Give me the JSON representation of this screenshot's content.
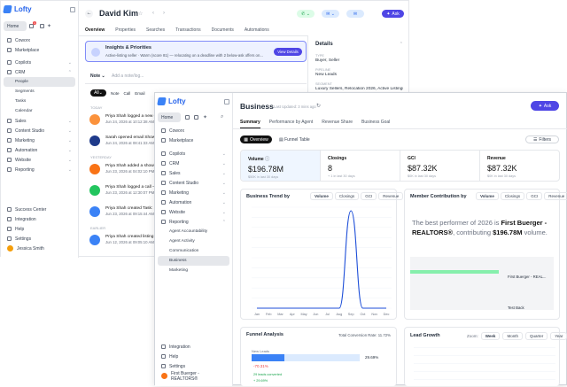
{
  "back_window": {
    "sidebar": {
      "brand": "Lofty",
      "badge": "1",
      "items": [
        {
          "label": "Home",
          "active": true
        },
        {
          "label": "Coworx"
        },
        {
          "label": "Marketplace"
        },
        {
          "label": "Copilots",
          "chev": true
        },
        {
          "label": "CRM",
          "chev": true
        }
      ],
      "crm_sub": [
        "People",
        "Segments",
        "Tasks",
        "Calendar"
      ],
      "items2": [
        "Sales",
        "Content Studio",
        "Marketing",
        "Automation",
        "Website",
        "Reporting"
      ],
      "bottom": [
        "Success Center",
        "Integration",
        "Help",
        "Settings"
      ],
      "user": "Jessica Smith"
    },
    "header": {
      "name": "David Kim",
      "ask": "Ask"
    },
    "tabs": [
      "Overview",
      "Properties",
      "Searches",
      "Transactions",
      "Documents",
      "Automations"
    ],
    "insight": {
      "title": "Insights & Priorities",
      "text": "Active-listing seller · Warm (score 81) — relocating on a deadline with 2 below-ask offers on...",
      "button": "View Details"
    },
    "note": {
      "label": "Note",
      "placeholder": "Add a note/log..."
    },
    "filters": {
      "all": "All",
      "note": "Note",
      "call": "Call",
      "email": "Email"
    },
    "timeline": [
      {
        "section": "TODAY",
        "text": "Priya Shah logged a new of",
        "date": "Jun 24, 2026 at 10:12:38 AM"
      },
      {
        "text": "Sarah opened email Showi",
        "date": "Jun 24, 2026 at 08:41:33 AM"
      },
      {
        "section": "YESTERDAY",
        "text": "Priya Shah added a showin",
        "date": "Jun 23, 2026 at 04:02:10 PM"
      },
      {
        "text": "Priya Shah logged a call —",
        "date": "Jun 23, 2026 at 12:30:07 PM"
      },
      {
        "text": "Priya Shah created Task: Se",
        "date": "Jun 23, 2026 at 09:15:44 AM"
      },
      {
        "section": "EARLIER",
        "text": "Priya Shah created listing b",
        "date": "Jun 12, 2026 at 09:05:10 AM"
      }
    ],
    "details": {
      "title": "Details",
      "type_label": "TYPE",
      "type": "Buyer, Seller",
      "pipeline_label": "PIPELINE",
      "pipeline": "New Leads",
      "segment_label": "SEGMENT",
      "segment": "Luxury Sellers, Relocation 2026, Active Listings"
    }
  },
  "front_window": {
    "sidebar": {
      "brand": "Lofty",
      "items": [
        "Home",
        "Coworx",
        "Marketplace"
      ],
      "items2": [
        "Copilots",
        "CRM",
        "Sales",
        "Content Studio",
        "Marketing",
        "Automation",
        "Website",
        "Reporting"
      ],
      "reporting_sub": [
        "Agent Accountability",
        "Agent Activity",
        "Communication",
        "Business",
        "Marketing"
      ],
      "bottom": [
        "Integration",
        "Help",
        "Settings"
      ],
      "user": "First Buerger - REALTORS®"
    },
    "header": {
      "title": "Business",
      "updated": "Last Updated: 3 mins ago",
      "ask": "Ask"
    },
    "tabs": [
      "Summary",
      "Performance by Agent",
      "Revenue Share",
      "Business Goal"
    ],
    "views": {
      "overview": "Overview",
      "funnel": "Funnel Table",
      "filters": "Filters"
    },
    "metrics": [
      {
        "label": "Volume",
        "value": "$196.78M",
        "sub": "$50K in last 30 days"
      },
      {
        "label": "Closings",
        "value": "8",
        "sub": "+ 1 in last 30 days"
      },
      {
        "label": "GCI",
        "value": "$87.32K",
        "sub": "$0K in last 30 days"
      },
      {
        "label": "Revenue",
        "value": "$87.32K",
        "sub": "$0K in last 30 days"
      }
    ],
    "trend": {
      "title": "Business Trend by",
      "pills": [
        "Volume",
        "Closings",
        "GCI",
        "Revenue"
      ]
    },
    "member": {
      "title": "Member Contribution by",
      "pills": [
        "Volume",
        "Closings",
        "GCI",
        "Revenue"
      ],
      "sentence_a": "The best performer of 2026 is ",
      "sentence_b": "First Buerger - REALTORS®",
      "sentence_c": ", contributing ",
      "sentence_d": "$196.78M",
      "sentence_e": " volume.",
      "bar1": "First Buerger - REAL...",
      "bar2": "Test Back"
    },
    "funnel": {
      "title": "Funnel Analysis",
      "rate": "Total Conversion Rate: 11.72%",
      "new_leads": "New Leads",
      "pct": "29.69%",
      "delta": "-70.31%",
      "converted": "29 leads converted",
      "plus": "+ 29.69%"
    },
    "growth": {
      "title": "Lead Growth",
      "zoom": "Zoom:",
      "pills": [
        "Week",
        "Month",
        "Quarter",
        "Year"
      ]
    }
  },
  "chart_data": {
    "type": "line",
    "categories": [
      "Jan",
      "Feb",
      "Mar",
      "Apr",
      "May",
      "Jun",
      "Jul",
      "Aug",
      "Sep",
      "Oct",
      "Nov",
      "Dec"
    ],
    "values": [
      0,
      0,
      0,
      0,
      0,
      0,
      0,
      0,
      200,
      0,
      0,
      0
    ],
    "title": "Business Trend by"
  }
}
